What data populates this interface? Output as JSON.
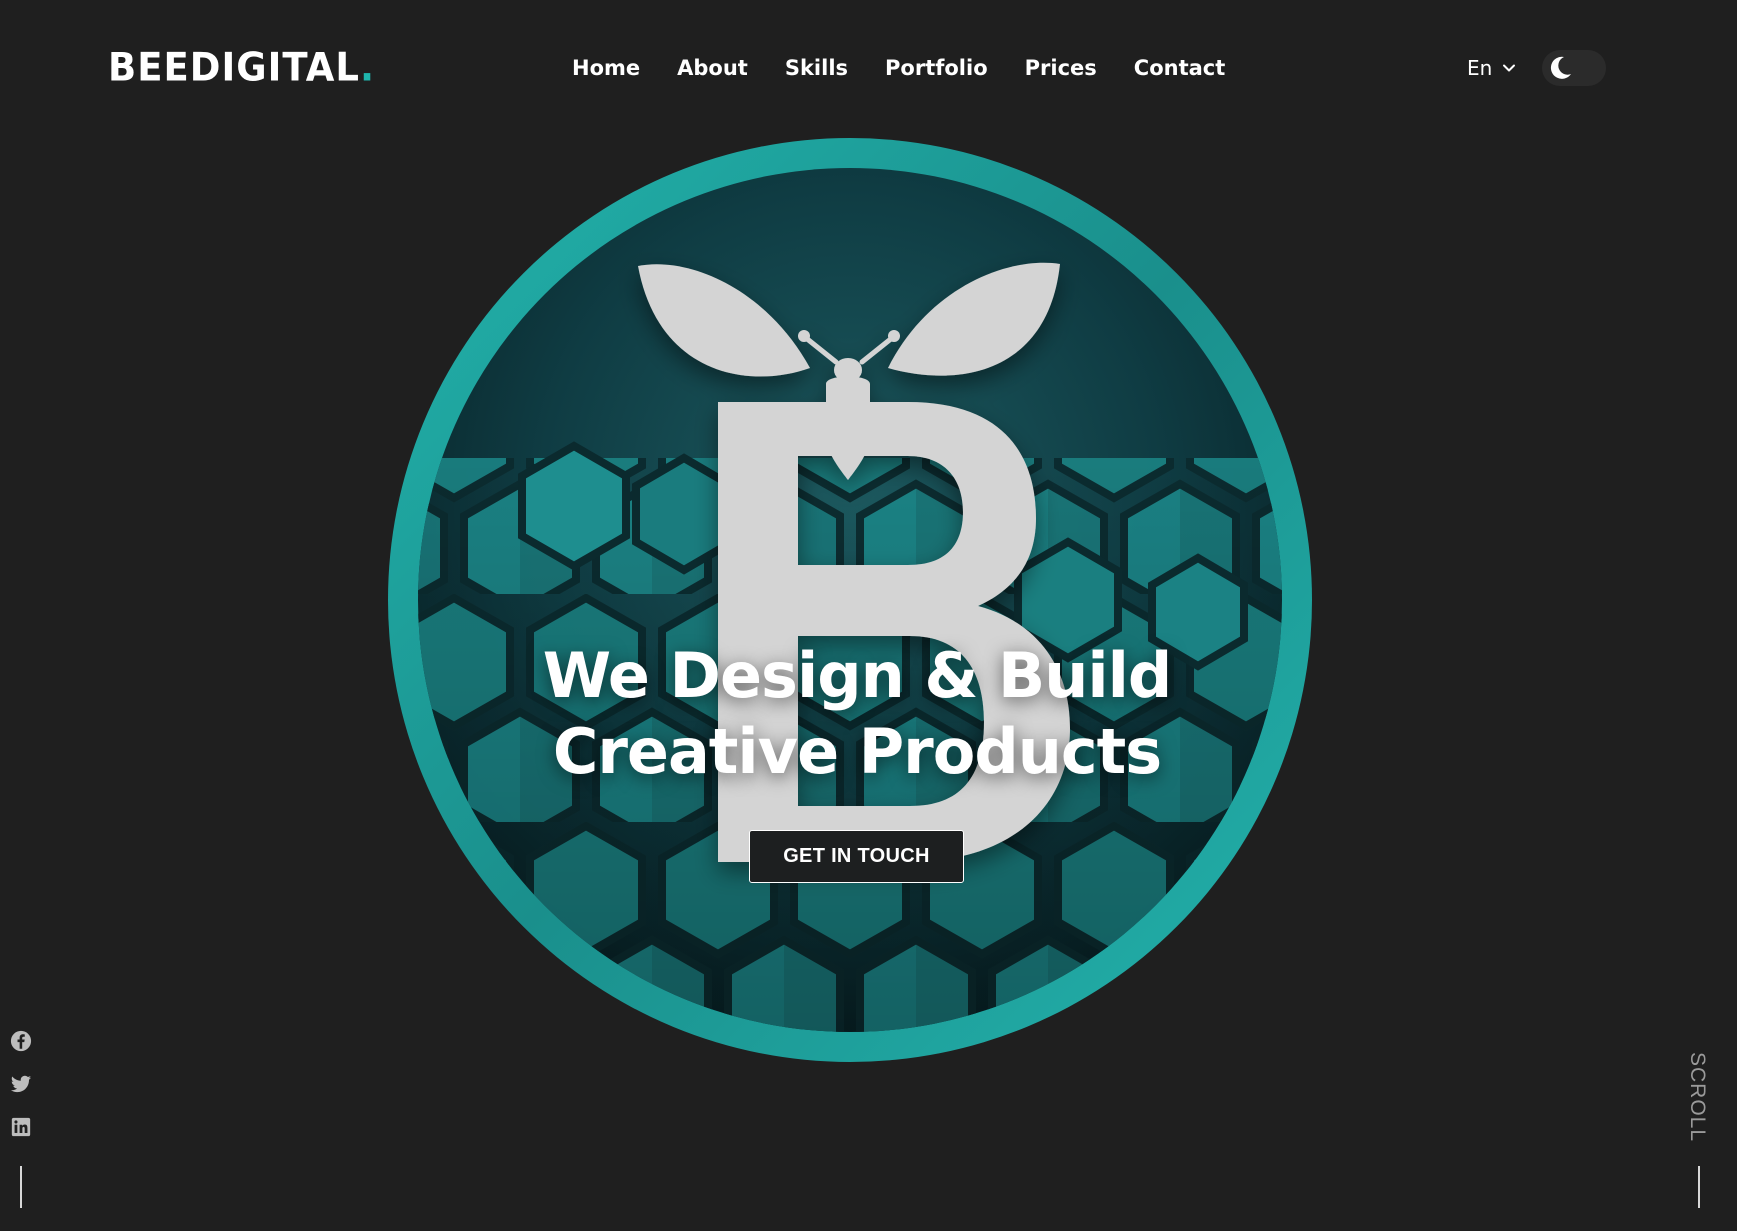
{
  "brand": {
    "name": "BEEDIGITAL",
    "dot": ".",
    "accent_color": "#1fb5ad"
  },
  "nav": {
    "items": [
      {
        "label": "Home"
      },
      {
        "label": "About"
      },
      {
        "label": "Skills"
      },
      {
        "label": "Portfolio"
      },
      {
        "label": "Prices"
      },
      {
        "label": "Contact"
      }
    ]
  },
  "language": {
    "selected": "En",
    "icon": "chevron-down-icon"
  },
  "theme_toggle": {
    "icon": "moon-icon",
    "mode": "dark"
  },
  "hero": {
    "title_line1": "We Design & Build",
    "title_line2": "Creative Products",
    "cta_label": "GET IN TOUCH",
    "image": "bee-logo-hexagon-circle"
  },
  "social": {
    "icons": [
      "facebook-icon",
      "twitter-icon",
      "linkedin-icon"
    ]
  },
  "scroll": {
    "label": "SCROLL"
  },
  "colors": {
    "background": "#1f1f1f",
    "teal": "#1fb5ad",
    "dark_teal": "#0e3c42",
    "logo_gray": "#d4d4d4"
  }
}
